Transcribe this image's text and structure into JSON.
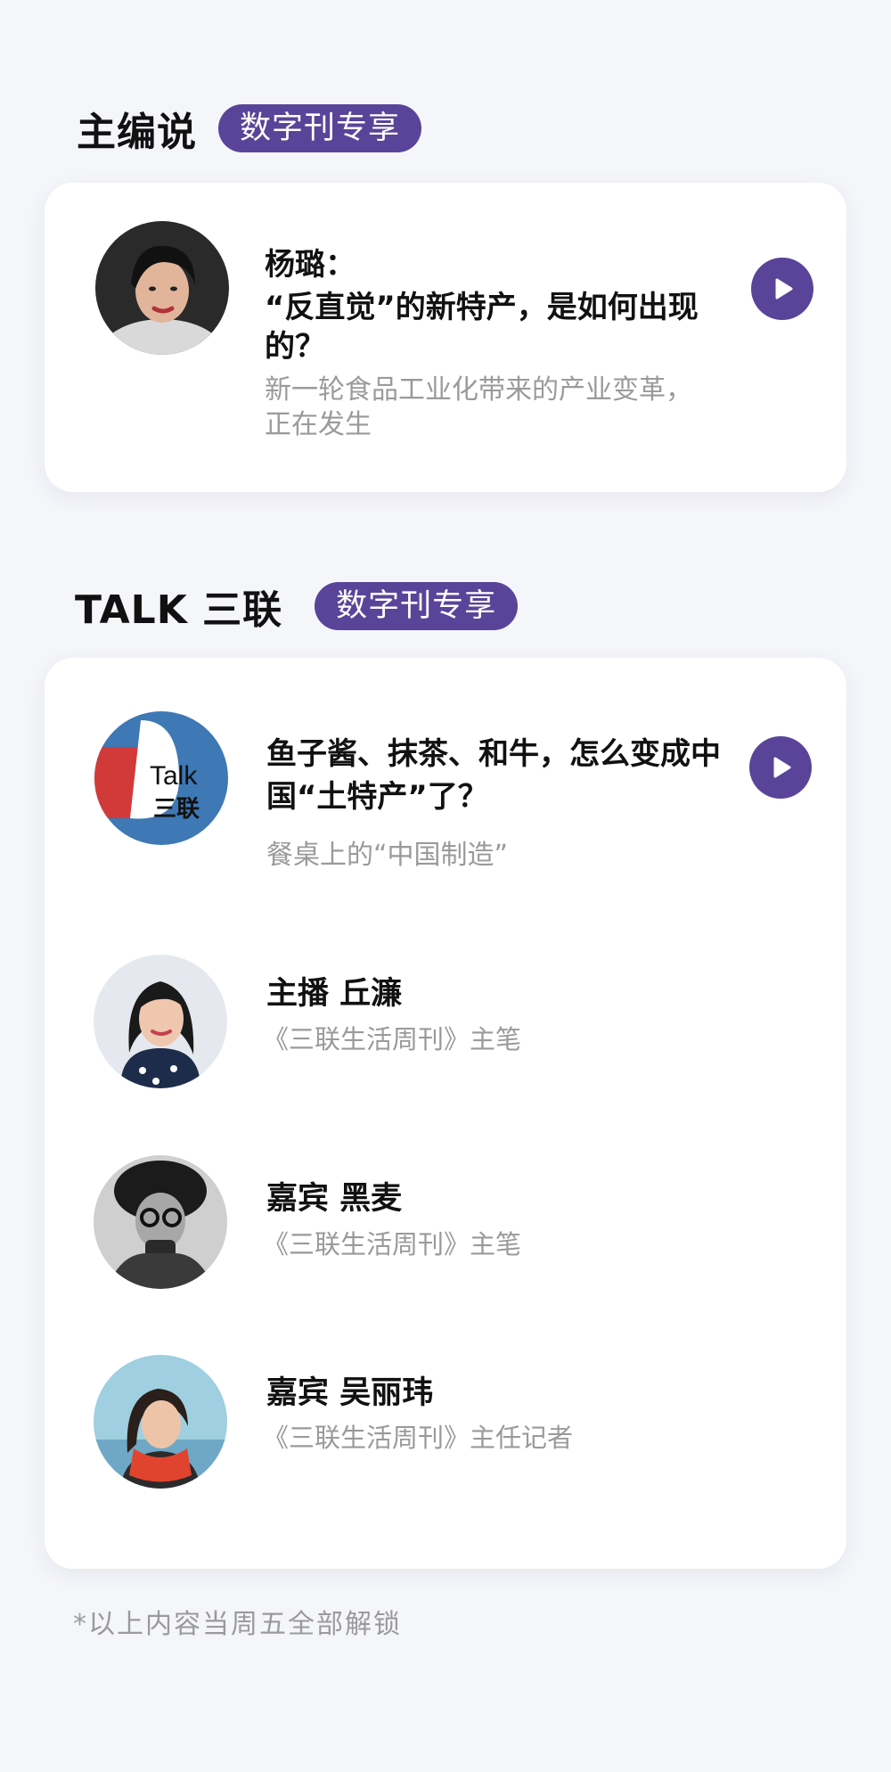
{
  "editor_section": {
    "title": "主编说",
    "badge": "数字刊专享",
    "item": {
      "title_line1": "杨璐：",
      "title_line2": "“反直觉”的新特产，是如何出现",
      "title_line3": "的？",
      "subtitle_line1": "新一轮食品工业化带来的产业变革，",
      "subtitle_line2": "正在发生"
    }
  },
  "talk_section": {
    "title": "TALK 三联",
    "badge": "数字刊专享",
    "episode": {
      "logo_text_top": "Talk",
      "logo_text_bottom": "三联",
      "title_line1": "鱼子酱、抹茶、和牛，怎么变成中",
      "title_line2": "国“土特产”了？",
      "subtitle": "餐桌上的“中国制造”"
    },
    "people": [
      {
        "name": "主播 丘濂",
        "role": "《三联生活周刊》主笔"
      },
      {
        "name": "嘉宾 黑麦",
        "role": "《三联生活周刊》主笔"
      },
      {
        "name": "嘉宾 吴丽玮",
        "role": "《三联生活周刊》主任记者"
      }
    ]
  },
  "footnote": "*以上内容当周五全部解锁",
  "colors": {
    "accent": "#5a4499",
    "background": "#f5f6fa",
    "card": "#ffffff",
    "secondary_text": "#9a9a9a",
    "talk_logo_blue": "#3e78b5",
    "talk_logo_red": "#d23a3a"
  },
  "icons": {
    "play": "play-icon"
  }
}
